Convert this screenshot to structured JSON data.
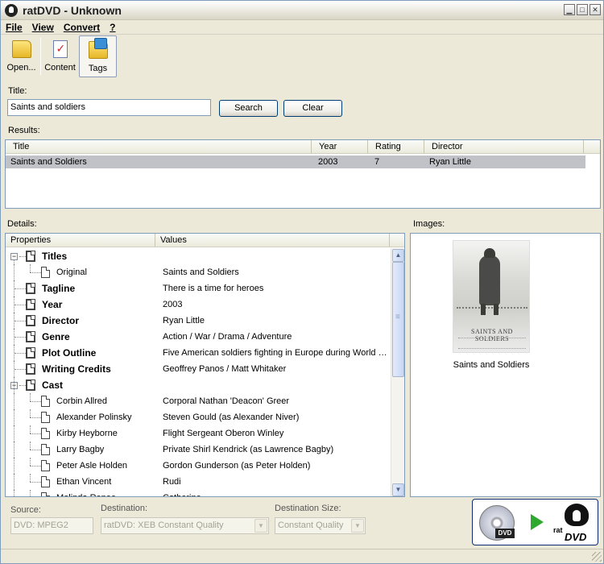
{
  "window": {
    "title": "ratDVD - Unknown"
  },
  "menu": [
    {
      "label": "File",
      "key": "F"
    },
    {
      "label": "View",
      "key": "V"
    },
    {
      "label": "Convert",
      "key": "C"
    },
    {
      "label": "?",
      "key": "?"
    }
  ],
  "toolbar": [
    {
      "label": "Open...",
      "icon": "folder-open-icon"
    },
    {
      "label": "Content",
      "icon": "checklist-icon"
    },
    {
      "label": "Tags",
      "icon": "tags-folder-icon",
      "active": true
    }
  ],
  "search": {
    "title_label": "Title:",
    "value": "Saints and soldiers",
    "search_button": "Search",
    "clear_button": "Clear",
    "results_label": "Results:"
  },
  "results": {
    "columns": [
      "Title",
      "Year",
      "Rating",
      "Director"
    ],
    "rows": [
      {
        "title": "Saints and Soldiers",
        "year": "2003",
        "rating": "7",
        "director": "Ryan Little"
      }
    ]
  },
  "details": {
    "label": "Details:",
    "columns": [
      "Properties",
      "Values"
    ],
    "rows": [
      {
        "name": "Titles",
        "value": "",
        "group": true,
        "expanded": true
      },
      {
        "name": "Original",
        "value": "Saints and Soldiers",
        "group": false
      },
      {
        "name": "Tagline",
        "value": "There is a time for heroes",
        "group": true
      },
      {
        "name": "Year",
        "value": "2003",
        "group": true
      },
      {
        "name": "Director",
        "value": "Ryan Little",
        "group": true
      },
      {
        "name": "Genre",
        "value": "Action / War / Drama / Adventure",
        "group": true
      },
      {
        "name": "Plot Outline",
        "value": "Five American soldiers fighting in Europe during World W...",
        "group": true
      },
      {
        "name": "Writing Credits",
        "value": "Geoffrey Panos / Matt Whitaker",
        "group": true
      },
      {
        "name": "Cast",
        "value": "",
        "group": true,
        "expanded": true
      },
      {
        "name": "Corbin Allred",
        "value": "Corporal Nathan 'Deacon' Greer",
        "group": false
      },
      {
        "name": "Alexander Polinsky",
        "value": "Steven Gould (as Alexander Niver)",
        "group": false
      },
      {
        "name": "Kirby Heyborne",
        "value": "Flight Sergeant Oberon Winley",
        "group": false
      },
      {
        "name": "Larry Bagby",
        "value": "Private Shirl Kendrick (as Lawrence Bagby)",
        "group": false
      },
      {
        "name": "Peter Asle Holden",
        "value": "Gordon Gunderson (as Peter Holden)",
        "group": false
      },
      {
        "name": "Ethan Vincent",
        "value": "Rudi",
        "group": false
      },
      {
        "name": "Melinda Renee",
        "value": "Catherine",
        "group": false
      }
    ]
  },
  "images": {
    "label": "Images:",
    "poster_title": "SAINTS AND SOLDIERS",
    "caption": "Saints and Soldiers"
  },
  "footer": {
    "source_label": "Source:",
    "source_value": "DVD: MPEG2",
    "destination_label": "Destination:",
    "destination_value": "ratDVD: XEB Constant Quality",
    "size_label": "Destination Size:",
    "size_value": "Constant Quality",
    "dvd_tag": "DVD",
    "rat_word": "rat",
    "rat_dvd": "DVD"
  }
}
